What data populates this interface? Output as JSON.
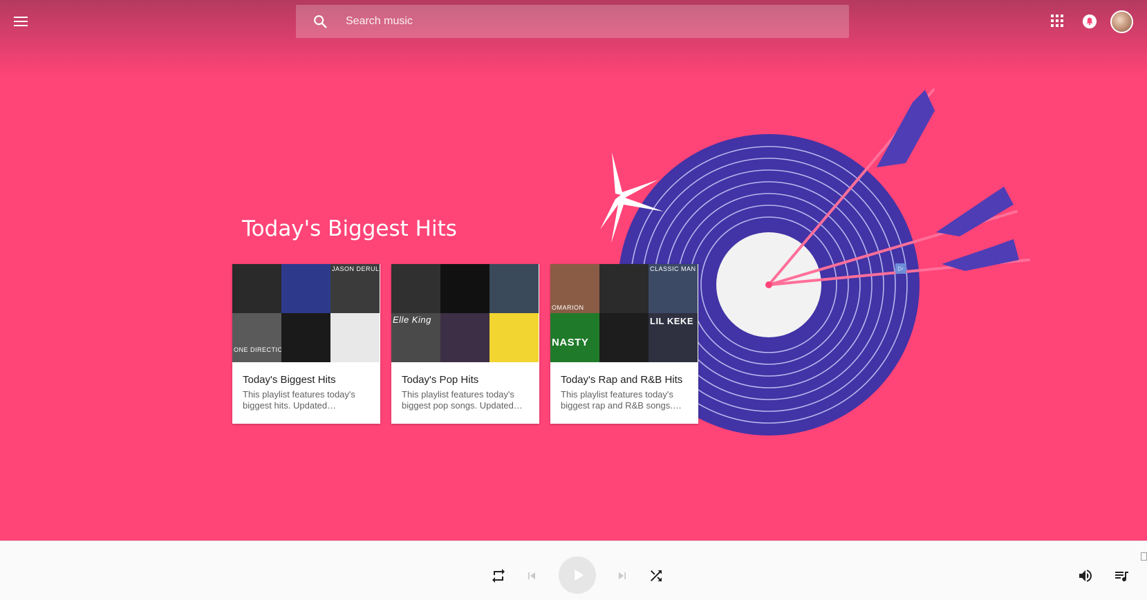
{
  "header": {
    "menu_icon": "hamburger-menu-icon",
    "search": {
      "placeholder": "Search music",
      "value": "",
      "icon": "search-icon"
    },
    "apps_icon": "apps-grid-icon",
    "notifications_icon": "bell-icon",
    "avatar": "user-avatar"
  },
  "hero": {
    "title": "Today's Biggest Hits",
    "background_color": "#ff4477",
    "illustration": "vinyl-target-with-arrows",
    "ad_badge": "ad-choices-icon"
  },
  "cards": [
    {
      "title": "Today's Biggest Hits",
      "description": "This playlist features today's biggest hits. Updated…",
      "tiles": [
        {
          "color": "#2a2a2a",
          "text": ""
        },
        {
          "color": "#2d3a8c",
          "text": ""
        },
        {
          "color": "#3b3b3b",
          "text": "JASON DERULO"
        },
        {
          "color": "#5a5a5a",
          "text": "ONE DIRECTION"
        },
        {
          "color": "#1a1a1a",
          "text": ""
        },
        {
          "color": "#e8e8e8",
          "text": ""
        }
      ]
    },
    {
      "title": "Today's Pop Hits",
      "description": "This playlist features today's biggest pop songs. Updated…",
      "tiles": [
        {
          "color": "#303030",
          "text": ""
        },
        {
          "color": "#111111",
          "text": ""
        },
        {
          "color": "#3a4a5a",
          "text": ""
        },
        {
          "color": "#4a4a4a",
          "text": "Elle King"
        },
        {
          "color": "#3d2f45",
          "text": ""
        },
        {
          "color": "#f2d530",
          "text": ""
        }
      ]
    },
    {
      "title": "Today's Rap and R&B Hits",
      "description": "This playlist features today's biggest rap and R&B songs.…",
      "tiles": [
        {
          "color": "#8a5c45",
          "text": "OMARION"
        },
        {
          "color": "#2b2b2b",
          "text": ""
        },
        {
          "color": "#3c4a66",
          "text": "CLASSIC MAN"
        },
        {
          "color": "#1f7a2a",
          "text": "NASTY"
        },
        {
          "color": "#1d1d1d",
          "text": ""
        },
        {
          "color": "#2f3040",
          "text": "LIL KEKE"
        }
      ]
    }
  ],
  "player": {
    "repeat_icon": "repeat-icon",
    "previous_icon": "skip-previous-icon",
    "play_icon": "play-icon",
    "next_icon": "skip-next-icon",
    "shuffle_icon": "shuffle-icon",
    "volume_icon": "volume-icon",
    "queue_icon": "queue-icon",
    "expand_icon": "expand-icon"
  }
}
